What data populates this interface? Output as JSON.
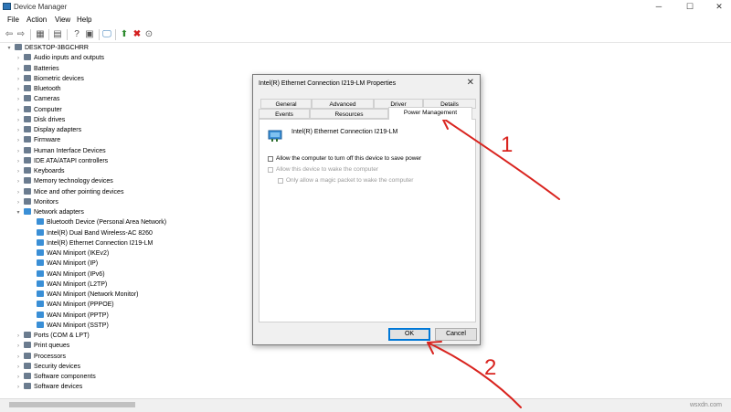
{
  "window": {
    "title": "Device Manager",
    "minimize": "─",
    "maximize": "☐",
    "close": "✕"
  },
  "menu": [
    "File",
    "Action",
    "View",
    "Help"
  ],
  "tree": {
    "root": "DESKTOP-3BGCHRR",
    "categories_before": [
      "Audio inputs and outputs",
      "Batteries",
      "Biometric devices",
      "Bluetooth",
      "Cameras",
      "Computer",
      "Disk drives",
      "Display adapters",
      "Firmware",
      "Human Interface Devices",
      "IDE ATA/ATAPI controllers",
      "Keyboards",
      "Memory technology devices",
      "Mice and other pointing devices",
      "Monitors"
    ],
    "network_adapters": {
      "label": "Network adapters",
      "children": [
        "Bluetooth Device (Personal Area Network)",
        "Intel(R) Dual Band Wireless-AC 8260",
        "Intel(R) Ethernet Connection I219-LM",
        "WAN Miniport (IKEv2)",
        "WAN Miniport (IP)",
        "WAN Miniport (IPv6)",
        "WAN Miniport (L2TP)",
        "WAN Miniport (Network Monitor)",
        "WAN Miniport (PPPOE)",
        "WAN Miniport (PPTP)",
        "WAN Miniport (SSTP)"
      ]
    },
    "categories_after": [
      "Ports (COM & LPT)",
      "Print queues",
      "Processors",
      "Security devices",
      "Software components",
      "Software devices"
    ]
  },
  "dialog": {
    "title": "Intel(R) Ethernet Connection I219-LM Properties",
    "close": "✕",
    "tabs_back": [
      "General",
      "Advanced",
      "Driver",
      "Details"
    ],
    "tabs_front": [
      "Events",
      "Resources",
      "Power Management"
    ],
    "active_tab": "Power Management",
    "device_name": "Intel(R) Ethernet Connection I219-LM",
    "options": [
      {
        "label": "Allow the computer to turn off this device to save power",
        "enabled": true,
        "checked": false
      },
      {
        "label": "Allow this device to wake the computer",
        "enabled": false,
        "checked": false
      },
      {
        "label": "Only allow a magic packet to wake the computer",
        "enabled": false,
        "checked": false
      }
    ],
    "ok_label": "OK",
    "cancel_label": "Cancel"
  },
  "annotations": {
    "arrow1": "1",
    "arrow2": "2",
    "color": "#d9241f"
  },
  "watermark": "wsxdn.com"
}
